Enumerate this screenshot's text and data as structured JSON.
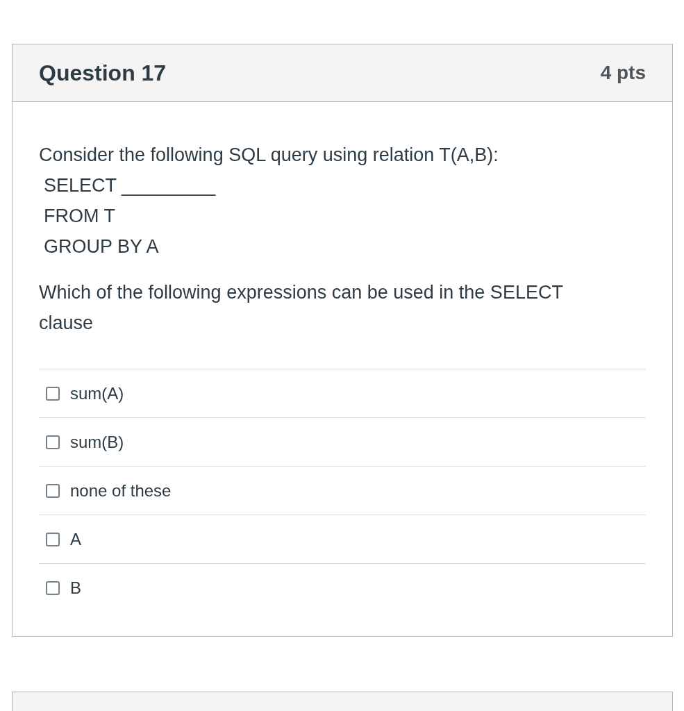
{
  "question": {
    "title": "Question 17",
    "points": "4 pts"
  },
  "body": {
    "prompt": "Consider the following SQL query using relation T(A,B):",
    "query_lines": [
      "SELECT _________",
      "FROM T",
      "GROUP BY A"
    ],
    "instruction": "Which of the following expressions can be used in the SELECT clause"
  },
  "options": [
    {
      "label": "sum(A)",
      "checked": false
    },
    {
      "label": "sum(B)",
      "checked": false
    },
    {
      "label": "none of these",
      "checked": false
    },
    {
      "label": "A",
      "checked": false
    },
    {
      "label": "B",
      "checked": false
    }
  ]
}
